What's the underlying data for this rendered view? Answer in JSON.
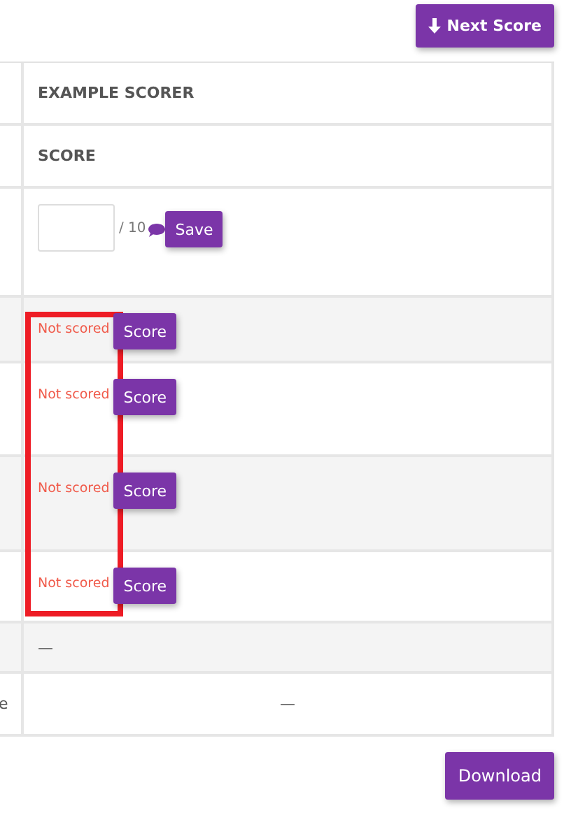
{
  "next_button": {
    "label": "Next Score"
  },
  "table": {
    "headers": [
      "EXAMPLE SCORER",
      "SCORE"
    ],
    "input_row": {
      "max": "/ 10",
      "save": "Save"
    },
    "rows": [
      {
        "kind": "unscored",
        "status": "Not scored",
        "action": "Score"
      },
      {
        "kind": "unscored",
        "status": "Not scored",
        "action": "Score"
      },
      {
        "kind": "unscored",
        "status": "Not scored",
        "action": "Score"
      },
      {
        "kind": "unscored",
        "status": "Not scored",
        "action": "Score"
      },
      {
        "kind": "dash",
        "value": "—"
      },
      {
        "kind": "total",
        "label": "e",
        "value": "—"
      }
    ]
  },
  "download_button": "Download"
}
